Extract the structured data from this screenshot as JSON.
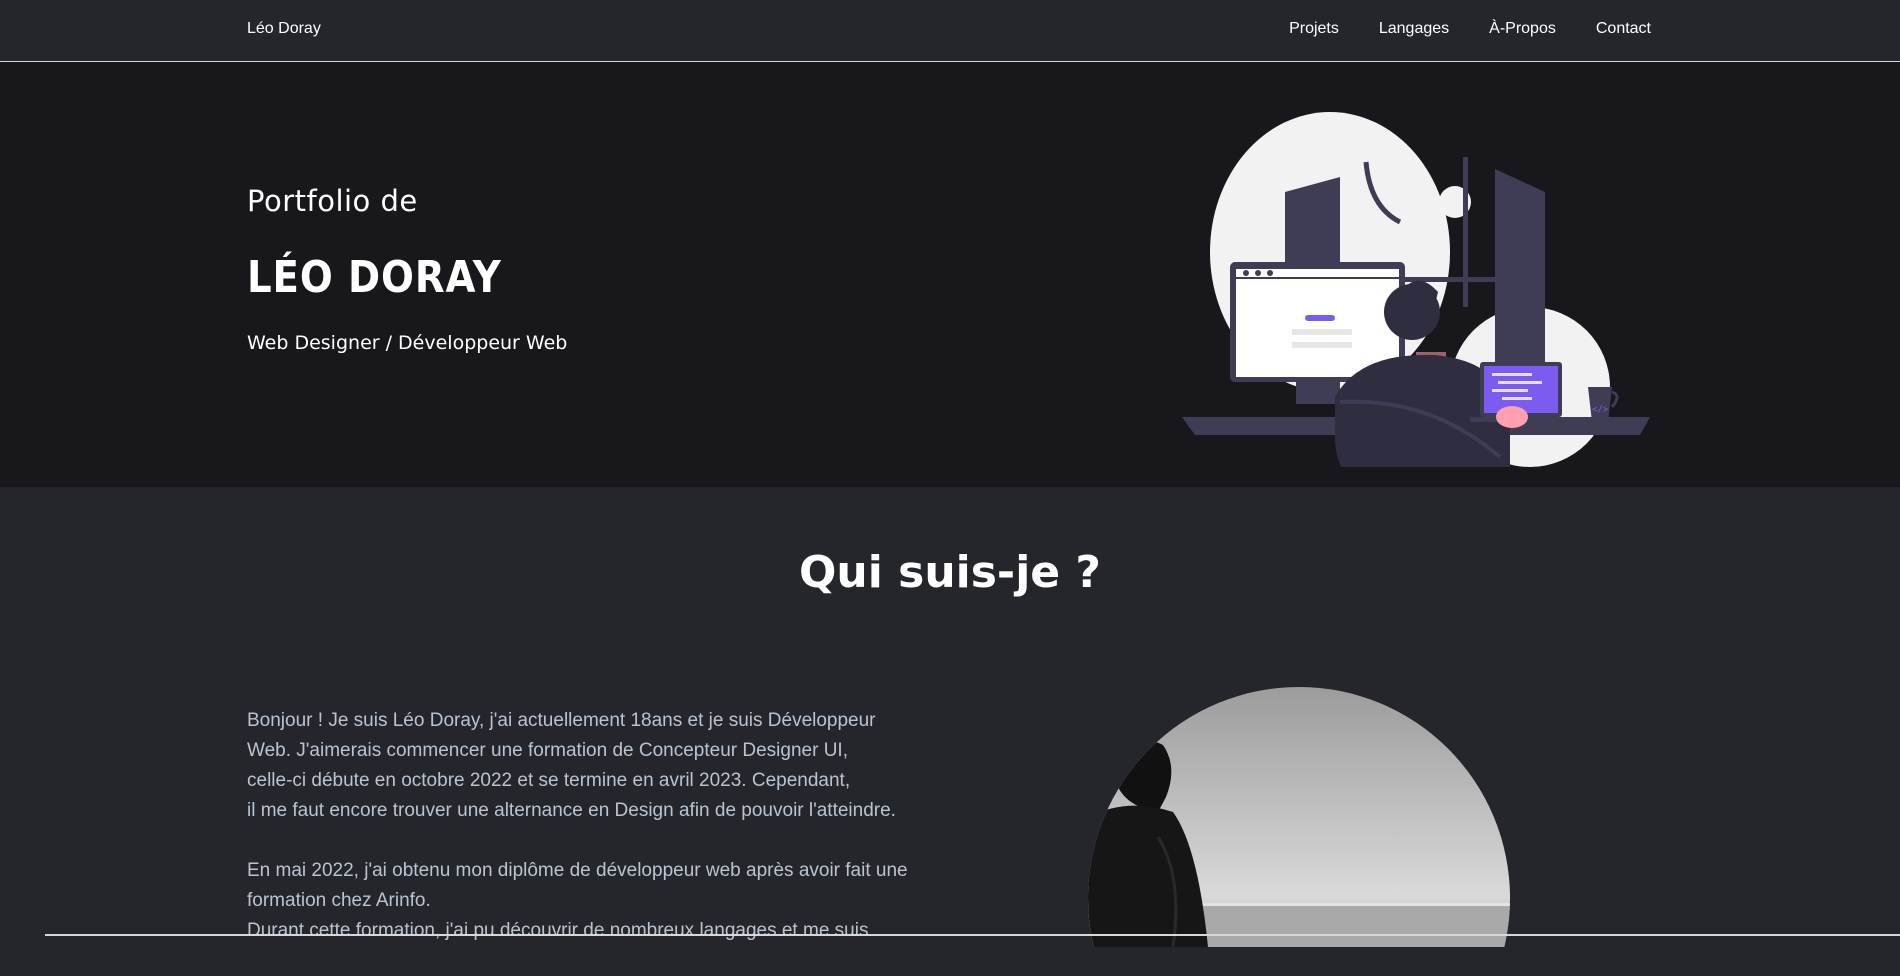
{
  "nav": {
    "brand": "Léo Doray",
    "links": [
      "Projets",
      "Langages",
      "À-Propos",
      "Contact"
    ]
  },
  "hero": {
    "intro": "Portfolio de",
    "name": "LÉO DORAY",
    "role": "Web Designer / Développeur Web"
  },
  "about": {
    "title": "Qui suis-je ?",
    "paragraph1": [
      "Bonjour ! Je suis Léo Doray, j'ai actuellement 18ans et je suis Développeur",
      "Web. J'aimerais commencer une formation de Concepteur Designer UI,",
      "celle-ci débute en octobre 2022 et se termine en avril 2023. Cependant,",
      "il me faut encore trouver une alternance en Design afin de pouvoir l'atteindre."
    ],
    "paragraph2": [
      "En mai 2022, j'ai obtenu mon diplôme de développeur web après avoir fait une",
      "formation chez Arinfo.",
      "Durant cette formation, j'ai pu découvrir de nombreux langages et me suis"
    ]
  },
  "colors": {
    "nav_bg": "#25262c",
    "hero_bg": "#18181c",
    "section_bg": "#25262c",
    "body_text": "#b9c4d2",
    "accent": "#7c5cf0"
  },
  "icons": [
    "developer-illustration",
    "profile-photo"
  ]
}
